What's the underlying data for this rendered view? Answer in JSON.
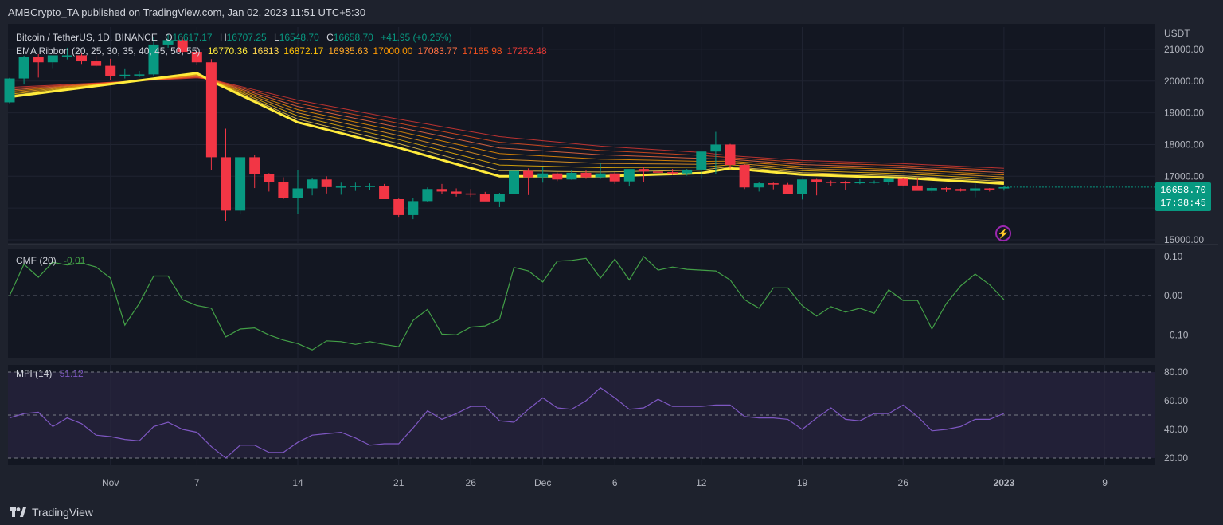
{
  "header": {
    "published_by": "AMBCrypto_TA published on TradingView.com, Jan 02, 2023 11:51 UTC+5:30"
  },
  "footer": {
    "brand": "TradingView"
  },
  "symbol_legend": {
    "title": "Bitcoin / TetherUS, 1D, BINANCE",
    "open_label": "O",
    "open": "16617.17",
    "high_label": "H",
    "high": "16707.25",
    "low_label": "L",
    "low": "16548.70",
    "close_label": "C",
    "close": "16658.70",
    "change": "+41.95 (+0.25%)"
  },
  "ema_legend": {
    "title": "EMA Ribbon (20, 25, 30, 35, 40, 45, 50, 55)",
    "values": [
      "16770.36",
      "16813",
      "16872.17",
      "16935.63",
      "17000.00",
      "17083.77",
      "17165.98",
      "17252.48"
    ],
    "colors": [
      "#ffeb3b",
      "#ffd54f",
      "#ffc107",
      "#ffa726",
      "#ff9800",
      "#ff7043",
      "#f4511e",
      "#e53935"
    ]
  },
  "price_axis": {
    "currency": "USDT",
    "ticks": [
      "21000.00",
      "20000.00",
      "19000.00",
      "18000.00",
      "17000.00",
      "16000.00",
      "15000.00"
    ]
  },
  "last_price": {
    "value": "16658.70",
    "countdown": "17:38:45"
  },
  "cmf_legend": {
    "title": "CMF (20)",
    "value": "-0.01",
    "ticks": [
      "0.10",
      "0.00",
      "−0.10"
    ]
  },
  "mfi_legend": {
    "title": "MFI (14)",
    "value": "51.12",
    "ticks": [
      "80.00",
      "60.00",
      "40.00",
      "20.00"
    ]
  },
  "time_axis": {
    "labels": [
      "Nov",
      "7",
      "14",
      "21",
      "26",
      "Dec",
      "6",
      "12",
      "19",
      "26",
      "2023",
      "9"
    ]
  },
  "colors": {
    "up": "#089981",
    "down": "#f23645",
    "background": "#1e222d",
    "cmf_line": "#43a047",
    "mfi_line": "#7e57c2",
    "mfi_band": "#2a2540"
  },
  "icons": {
    "flash": "flash-icon",
    "logo": "tradingview-logo-icon"
  },
  "chart_data": [
    {
      "type": "candlestick",
      "title": "Bitcoin / TetherUS, 1D, BINANCE",
      "ylabel": "USDT",
      "ylim": [
        14900,
        21700
      ],
      "dates": [
        "Oct 25",
        "Oct 26",
        "Oct 27",
        "Oct 28",
        "Oct 29",
        "Oct 30",
        "Oct 31",
        "Nov 1",
        "Nov 2",
        "Nov 3",
        "Nov 4",
        "Nov 5",
        "Nov 6",
        "Nov 7",
        "Nov 8",
        "Nov 9",
        "Nov 10",
        "Nov 11",
        "Nov 12",
        "Nov 13",
        "Nov 14",
        "Nov 15",
        "Nov 16",
        "Nov 17",
        "Nov 18",
        "Nov 19",
        "Nov 20",
        "Nov 21",
        "Nov 22",
        "Nov 23",
        "Nov 24",
        "Nov 25",
        "Nov 26",
        "Nov 27",
        "Nov 28",
        "Nov 29",
        "Nov 30",
        "Dec 1",
        "Dec 2",
        "Dec 3",
        "Dec 4",
        "Dec 5",
        "Dec 6",
        "Dec 7",
        "Dec 8",
        "Dec 9",
        "Dec 10",
        "Dec 11",
        "Dec 12",
        "Dec 13",
        "Dec 14",
        "Dec 15",
        "Dec 16",
        "Dec 17",
        "Dec 18",
        "Dec 19",
        "Dec 20",
        "Dec 21",
        "Dec 22",
        "Dec 23",
        "Dec 24",
        "Dec 25",
        "Dec 26",
        "Dec 27",
        "Dec 28",
        "Dec 29",
        "Dec 30",
        "Dec 31",
        "Jan 1",
        "Jan 2"
      ],
      "open": [
        19330,
        20080,
        20770,
        20590,
        20810,
        20810,
        20620,
        20480,
        20150,
        20200,
        20210,
        21150,
        21290,
        20920,
        20590,
        17600,
        15920,
        17600,
        17070,
        16810,
        16330,
        16620,
        16900,
        16660,
        16680,
        16700,
        16700,
        16280,
        15780,
        16220,
        16600,
        16520,
        16460,
        16430,
        16210,
        16440,
        17170,
        16970,
        17090,
        16900,
        17110,
        16970,
        17090,
        16840,
        17230,
        17150,
        17130,
        17090,
        17210,
        17780,
        18000,
        17360,
        16650,
        16780,
        16740,
        16440,
        16900,
        16830,
        16820,
        16780,
        16830,
        16830,
        16920,
        16710,
        16540,
        16630,
        16600,
        16540,
        16620,
        16617
      ],
      "high": [
        20100,
        20800,
        20850,
        20780,
        21050,
        20880,
        20800,
        20700,
        20400,
        20320,
        21400,
        21480,
        21370,
        21050,
        20690,
        18500,
        17250,
        17660,
        17100,
        16970,
        17200,
        16950,
        17000,
        16800,
        16800,
        16780,
        16760,
        16300,
        16330,
        16650,
        16760,
        16620,
        16600,
        16510,
        16480,
        16580,
        17250,
        17300,
        17120,
        17200,
        17180,
        17430,
        17130,
        17120,
        17300,
        17330,
        17230,
        17230,
        17280,
        18400,
        18020,
        17380,
        16810,
        16800,
        16790,
        16760,
        16920,
        16870,
        16860,
        16910,
        16870,
        16860,
        16950,
        16950,
        16680,
        16660,
        16620,
        16800,
        16630,
        16707
      ],
      "low": [
        19300,
        19890,
        20110,
        20410,
        20680,
        20540,
        20450,
        20020,
        20080,
        20120,
        20170,
        21050,
        20880,
        20520,
        17200,
        15600,
        15800,
        16630,
        16520,
        16280,
        15820,
        16400,
        16460,
        16420,
        16540,
        16580,
        16290,
        15700,
        15650,
        16180,
        16450,
        16360,
        16350,
        16300,
        16030,
        16390,
        16410,
        16800,
        16850,
        16890,
        16920,
        16920,
        16760,
        16680,
        16810,
        17060,
        17040,
        17020,
        16920,
        17080,
        17250,
        16600,
        16520,
        16590,
        16710,
        16270,
        16400,
        16680,
        16570,
        16750,
        16770,
        16730,
        16680,
        16550,
        16480,
        16510,
        16520,
        16340,
        16520,
        16548
      ],
      "close": [
        20080,
        20770,
        20590,
        20810,
        20810,
        20620,
        20480,
        20150,
        20200,
        20210,
        21150,
        21290,
        20920,
        20590,
        17600,
        15920,
        17600,
        17070,
        16810,
        16330,
        16620,
        16900,
        16660,
        16680,
        16700,
        16700,
        16280,
        15780,
        16220,
        16600,
        16520,
        16460,
        16430,
        16210,
        16440,
        17170,
        16970,
        17090,
        16900,
        17110,
        16970,
        17090,
        16840,
        17230,
        17150,
        17130,
        17090,
        17210,
        17780,
        18000,
        17360,
        16650,
        16780,
        16740,
        16440,
        16900,
        16830,
        16820,
        16780,
        16830,
        16830,
        16920,
        16710,
        16540,
        16630,
        16600,
        16540,
        16620,
        16617,
        16658
      ]
    },
    {
      "type": "line",
      "title": "EMA Ribbon (20, 25, 30, 35, 40, 45, 50, 55)",
      "x": [
        "Oct 25",
        "Nov 7",
        "Nov 8",
        "Nov 14",
        "Nov 21",
        "Nov 28",
        "Dec 5",
        "Dec 12",
        "Dec 14",
        "Dec 19",
        "Dec 26",
        "Jan 2"
      ],
      "series": [
        {
          "name": "20",
          "values": [
            19500,
            20250,
            20000,
            18700,
            17900,
            17000,
            17000,
            17100,
            17250,
            17050,
            16950,
            16770
          ]
        },
        {
          "name": "55",
          "values": [
            19800,
            20100,
            20050,
            19400,
            18800,
            18250,
            17950,
            17750,
            17650,
            17500,
            17400,
            17252
          ]
        }
      ]
    },
    {
      "type": "line",
      "title": "CMF (20)",
      "ylim": [
        -0.16,
        0.12
      ],
      "values": [
        0.0,
        0.08,
        0.047,
        0.085,
        0.078,
        0.083,
        0.073,
        0.045,
        -0.075,
        -0.02,
        0.05,
        0.05,
        -0.01,
        -0.025,
        -0.032,
        -0.105,
        -0.085,
        -0.082,
        -0.1,
        -0.113,
        -0.122,
        -0.138,
        -0.115,
        -0.117,
        -0.124,
        -0.117,
        -0.124,
        -0.13,
        -0.063,
        -0.035,
        -0.098,
        -0.1,
        -0.08,
        -0.077,
        -0.06,
        0.072,
        0.063,
        0.035,
        0.088,
        0.09,
        0.095,
        0.045,
        0.093,
        0.04,
        0.1,
        0.065,
        0.073,
        0.067,
        0.065,
        0.063,
        0.04,
        -0.01,
        -0.032,
        0.02,
        0.02,
        -0.025,
        -0.052,
        -0.028,
        -0.042,
        -0.032,
        -0.045,
        0.015,
        -0.012,
        -0.012,
        -0.085,
        -0.02,
        0.025,
        0.055,
        0.028,
        -0.01
      ]
    },
    {
      "type": "line",
      "title": "MFI (14)",
      "ylim": [
        15,
        85
      ],
      "band": [
        20,
        80
      ],
      "values": [
        48,
        51,
        52,
        42,
        48,
        44,
        36,
        35,
        33,
        32,
        42,
        45,
        40,
        38,
        28,
        20,
        29,
        29,
        24,
        24,
        31,
        36,
        37,
        38,
        34,
        29,
        30,
        30,
        41,
        53,
        47,
        51,
        56,
        56,
        46,
        45,
        54,
        62,
        55,
        54,
        60,
        69,
        62,
        54,
        55,
        61,
        56,
        56,
        56,
        57,
        57,
        49,
        48,
        48,
        47,
        40,
        48,
        55,
        47,
        46,
        51,
        51,
        57,
        49,
        39,
        40,
        42,
        47,
        47,
        51.12
      ]
    }
  ]
}
